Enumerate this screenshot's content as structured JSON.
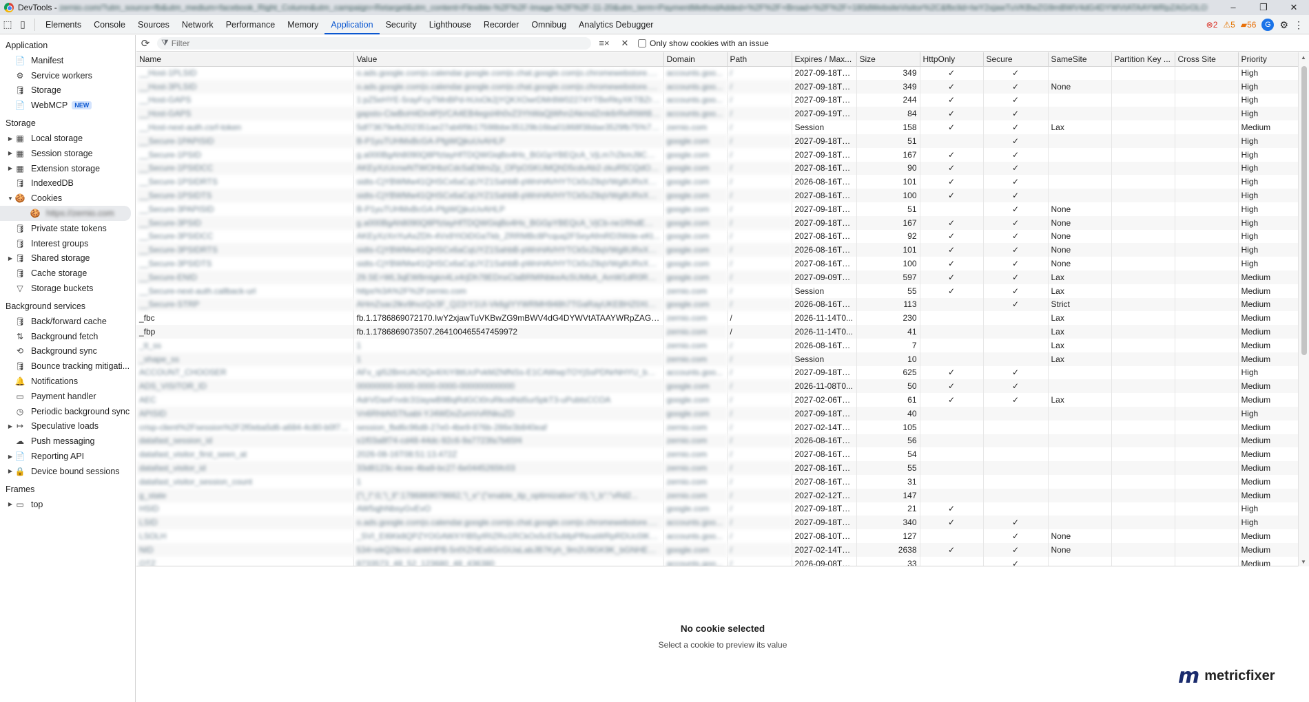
{
  "titlebar": {
    "app": "DevTools",
    "url": "zernio.com/?utm_source=fb&utm_medium=facebook_Right_Column&utm_campaign=Retarget&utm_content=Flexible-%2F%2F-Image-%2F%2F-11-20&utm_term=PaymentMethodAdded+%2F%2F+Broad+%2F%2F+180dWebsiteVisitor%2C&fbclid=IwY2xjawTuVKBwZG9mBWV4dG4DYWVtATAAYWRpZAGrOLO",
    "min": "–",
    "max": "❐",
    "close": "✕"
  },
  "tabs": [
    "Elements",
    "Console",
    "Sources",
    "Network",
    "Performance",
    "Memory",
    "Application",
    "Security",
    "Lighthouse",
    "Recorder",
    "Omnibug",
    "Analytics Debugger"
  ],
  "active_tab": "Application",
  "status": {
    "errors": "2",
    "warnings": "5",
    "issues": "56"
  },
  "sidebar": {
    "application_header": "Application",
    "application_items": [
      {
        "label": "Manifest",
        "icon": "📄"
      },
      {
        "label": "Service workers",
        "icon": "⚙"
      },
      {
        "label": "Storage",
        "icon": "🛢"
      },
      {
        "label": "WebMCP",
        "icon": "📄",
        "badge": "NEW"
      }
    ],
    "storage_header": "Storage",
    "storage_items": [
      {
        "label": "Local storage",
        "icon": "▦",
        "arrow": "▶"
      },
      {
        "label": "Session storage",
        "icon": "▦",
        "arrow": "▶"
      },
      {
        "label": "Extension storage",
        "icon": "▦",
        "arrow": "▶"
      },
      {
        "label": "IndexedDB",
        "icon": "🛢",
        "arrow": ""
      },
      {
        "label": "Cookies",
        "icon": "🍪",
        "arrow": "▼"
      },
      {
        "label": "https://zernio.com",
        "icon": "🍪",
        "arrow": "",
        "child": true
      },
      {
        "label": "Private state tokens",
        "icon": "🛢",
        "arrow": ""
      },
      {
        "label": "Interest groups",
        "icon": "🛢",
        "arrow": ""
      },
      {
        "label": "Shared storage",
        "icon": "🛢",
        "arrow": "▶"
      },
      {
        "label": "Cache storage",
        "icon": "🛢",
        "arrow": ""
      },
      {
        "label": "Storage buckets",
        "icon": "▽",
        "arrow": ""
      }
    ],
    "background_header": "Background services",
    "background_items": [
      {
        "label": "Back/forward cache",
        "icon": "🛢",
        "arrow": ""
      },
      {
        "label": "Background fetch",
        "icon": "⇅",
        "arrow": ""
      },
      {
        "label": "Background sync",
        "icon": "⟲",
        "arrow": ""
      },
      {
        "label": "Bounce tracking mitigati...",
        "icon": "🛢",
        "arrow": ""
      },
      {
        "label": "Notifications",
        "icon": "🔔",
        "arrow": ""
      },
      {
        "label": "Payment handler",
        "icon": "▭",
        "arrow": ""
      },
      {
        "label": "Periodic background sync",
        "icon": "◷",
        "arrow": ""
      },
      {
        "label": "Speculative loads",
        "icon": "↦",
        "arrow": "▶"
      },
      {
        "label": "Push messaging",
        "icon": "☁",
        "arrow": ""
      },
      {
        "label": "Reporting API",
        "icon": "📄",
        "arrow": "▶"
      },
      {
        "label": "Device bound sessions",
        "icon": "🔒",
        "arrow": "▶"
      }
    ],
    "frames_header": "Frames",
    "frames_items": [
      {
        "label": "top",
        "icon": "▭",
        "arrow": "▶"
      }
    ]
  },
  "toolbar": {
    "refresh_icon": "⟳",
    "filter_placeholder": "Filter",
    "clear_filtered_icon": "≡×",
    "clear_icon": "✕",
    "only_issue_label": "Only show cookies with an issue"
  },
  "table": {
    "columns": [
      "Name",
      "Value",
      "Domain",
      "Path",
      "Expires / Max...",
      "Size",
      "HttpOnly",
      "Secure",
      "SameSite",
      "Partition Key ...",
      "Cross Site",
      "Priority"
    ],
    "rows": [
      [
        "__Host-1PLSID",
        "o.ads.google.com|o.calendar.google.com|o.chat.google.com|o.chromewebstore.go...",
        "accounts.goo...",
        "/",
        "2027-09-18T1...",
        "349",
        "✓",
        "✓",
        "",
        "",
        "",
        "High"
      ],
      [
        "__Host-3PLSID",
        "o.ads.google.com|o.calendar.google.com|o.chat.google.com|o.chromewebstore.go...",
        "accounts.goo...",
        "/",
        "2027-09-18T1...",
        "349",
        "✓",
        "✓",
        "None",
        "",
        "",
        "High"
      ],
      [
        "__Host-GAPS",
        "1:pZ5eHYE-5rayFcyTMnBPd-hUoOk2jYQKXOwrDMr8W02274YTBeRkyXKTBZrHT...",
        "accounts.goo...",
        "/",
        "2027-09-18T1...",
        "244",
        "✓",
        "✓",
        "",
        "",
        "",
        "High"
      ],
      [
        "__Host-GAPS",
        "gapsto-CiwBoH4Dn4PjVCA4EB4egsI4h0vZ3YhWaQjWhn2AkmdZmk6rReRtWt8B...",
        "accounts.goo...",
        "/",
        "2027-09-19T2...",
        "84",
        "✓",
        "✓",
        "",
        "",
        "",
        "High"
      ],
      [
        "__Host-next-auth.csrf-token",
        "5df73679efb202351ae27ab6f9b17598bbe35129b16ba01868f38dae3529fb75%7C...",
        "zernio.com",
        "/",
        "Session",
        "158",
        "✓",
        "✓",
        "Lax",
        "",
        "",
        "Medium"
      ],
      [
        "__Secure-1PAPISID",
        "B-P1yuTUHMxBcGA-PfgWQjkuUvAHLP",
        "google.com",
        "/",
        "2027-09-18T1...",
        "51",
        "",
        "✓",
        "",
        "",
        "",
        "High"
      ],
      [
        "__Secure-1PSID",
        "g.a000BgAh8090Q8PfzlayHfTDQWGiqBo4Hs_BGGpYBEQcA_VjLm7rZkmJ9CXFB...",
        "google.com",
        "/",
        "2027-09-18T1...",
        "167",
        "✓",
        "✓",
        "",
        "",
        "",
        "High"
      ],
      [
        "__Secure-1PSIDCC",
        "AKEyXzUcnwNTWOHbzCdc5aEMmZp_OPpOSKUMQhD5cdvAb2-zkuR5CQdOkxyQ...",
        "google.com",
        "/",
        "2027-08-16T0...",
        "90",
        "✓",
        "✓",
        "",
        "",
        "",
        "High"
      ],
      [
        "__Secure-1PSIDRTS",
        "sidts-CjYBWMw41QHSCx6aCqUYZ1SahbB-pWnHAVHYTCk5cZ8qVWg8URxXxBsfb...",
        "google.com",
        "/",
        "2026-08-16T0...",
        "101",
        "✓",
        "✓",
        "",
        "",
        "",
        "High"
      ],
      [
        "__Secure-1PSIDTS",
        "sidts-CjYBWMw41QHSCx6aCqUYZ1SahbB-pWnHAVHYTCk5cZ8qVWg8URxXxBsfb...",
        "google.com",
        "/",
        "2027-08-16T0...",
        "100",
        "✓",
        "✓",
        "",
        "",
        "",
        "High"
      ],
      [
        "__Secure-3PAPISID",
        "B-P1yuTUHMxBcGA-PfgWQjkuUvAHLP",
        "google.com",
        "/",
        "2027-09-18T1...",
        "51",
        "",
        "✓",
        "None",
        "",
        "",
        "High"
      ],
      [
        "__Secure-3PSID",
        "g.a000BgAh8090Q8PfzlayHfTDQWGiqBo4Hs_BGGpYBEQcA_VjCb-ne1RhdEWgJ...",
        "google.com",
        "/",
        "2027-09-18T1...",
        "167",
        "✓",
        "✓",
        "None",
        "",
        "",
        "High"
      ],
      [
        "__Secure-3PSIDCC",
        "AKEyXzXnYuAxZDh-4Vx9YiOiDGaTkb_ZRRMBc8Pcquq2FSeyAfmRD3Wde-eKt...",
        "google.com",
        "/",
        "2027-08-16T0...",
        "92",
        "✓",
        "✓",
        "None",
        "",
        "",
        "High"
      ],
      [
        "__Secure-3PSIDRTS",
        "sidts-CjYBWMw41QHSCx6aCqUYZ1SahbB-pWnHAVHYTCk5cZ8qVWg8URxXxBsfb...",
        "google.com",
        "/",
        "2026-08-16T0...",
        "101",
        "✓",
        "✓",
        "None",
        "",
        "",
        "High"
      ],
      [
        "__Secure-3PSIDTS",
        "sidts-CjYBWMw41QHSCx6aCqUYZ1SahbB-pWnHAVHYTCk5cZ8qVWg8URxXxBsfb...",
        "google.com",
        "/",
        "2027-08-16T0...",
        "100",
        "✓",
        "✓",
        "None",
        "",
        "",
        "High"
      ],
      [
        "__Secure-ENID",
        "29.SE=WL3qEW8mlgkn4Lx4rjDh78EDnxClaBRMINbkeAc5UMbA_AmW1dR0RUm...",
        "google.com",
        "/",
        "2027-09-09T1...",
        "597",
        "✓",
        "✓",
        "Lax",
        "",
        "",
        "Medium"
      ],
      [
        "__Secure-next-auth.callback-url",
        "https%3A%2F%2Fzernio.com",
        "zernio.com",
        "/",
        "Session",
        "55",
        "✓",
        "✓",
        "Lax",
        "",
        "",
        "Medium"
      ],
      [
        "__Secure-STRP",
        "AHmZsac2lkv9hvzQv3F_Q22rY1UI-Vk6gIYYWRMH948h7TGaRayUKEBHZ0Xt63k...",
        "google.com",
        "/",
        "2026-08-16T0...",
        "113",
        "",
        "✓",
        "Strict",
        "",
        "",
        "Medium"
      ],
      [
        "_fbc",
        "fb.1.1786869072170.IwY2xjawTuVKBwZG9mBWV4dG4DYWVtATAAYWRpZAGrOLO...",
        "zernio.com",
        "/",
        "2026-11-14T0...",
        "230",
        "",
        "",
        "Lax",
        "",
        "",
        "Medium"
      ],
      [
        "_fbp",
        "fb.1.1786869073507.264100465547459972",
        "zernio.com",
        "/",
        "2026-11-14T0...",
        "41",
        "",
        "",
        "Lax",
        "",
        "",
        "Medium"
      ],
      [
        "_tt_ss",
        "1",
        "zernio.com",
        "/",
        "2026-08-16T0...",
        "7",
        "",
        "",
        "Lax",
        "",
        "",
        "Medium"
      ],
      [
        "_shape_ss",
        "1",
        "zernio.com",
        "/",
        "Session",
        "10",
        "",
        "",
        "Lax",
        "",
        "",
        "Medium"
      ],
      [
        "ACCOUNT_CHOOSER",
        "AFx_qI52BmUAOIQx4IXiY8ttUcPvkMZNfNSs-E1CAWwpTOYjSsPDNrNHYU_bACRb...",
        "accounts.goo...",
        "/",
        "2027-09-18T1...",
        "625",
        "✓",
        "✓",
        "",
        "",
        "",
        "High"
      ],
      [
        "ADS_VISITOR_ID",
        "00000000-0000-0000-0000-000000000000",
        "google.com",
        "/",
        "2026-11-08T0...",
        "50",
        "✓",
        "✓",
        "",
        "",
        "",
        "Medium"
      ],
      [
        "AEC",
        "AdrVDaxFrvdc31laywB9BqRdGCt0ruRkodNd5ur5pkT3-uPubtsCCOA",
        "google.com",
        "/",
        "2027-02-06T0...",
        "61",
        "✓",
        "✓",
        "Lax",
        "",
        "",
        "Medium"
      ],
      [
        "APISID",
        "Vn6RhbNSTfuabl-YJ4WDoZumVvRNkuZD",
        "google.com",
        "/",
        "2027-09-18T1...",
        "40",
        "",
        "",
        "",
        "",
        "",
        "High"
      ],
      [
        "crisp-client%2Fsession%2F2f0eba5d6-a684-4c80-b0f7-2...",
        "session_fbd6c96d8-27e0-4be9-876b-286e3b840eaf",
        "zernio.com",
        "/",
        "2027-02-14T2...",
        "105",
        "",
        "",
        "",
        "",
        "",
        "Medium"
      ],
      [
        "datafast_session_id",
        "s1f03a8f74-cd48-44dc-92c6-9a7723fa7b65f4",
        "zernio.com",
        "/",
        "2026-08-16T0...",
        "56",
        "",
        "",
        "",
        "",
        "",
        "Medium"
      ],
      [
        "datafast_visitor_first_seen_at",
        "2026-08-16T08:51:13.472Z",
        "zernio.com",
        "/",
        "2027-08-16T0...",
        "54",
        "",
        "",
        "",
        "",
        "",
        "Medium"
      ],
      [
        "datafast_visitor_id",
        "33d8123c-4cee-4ba9-bc27-6e0445265fc03",
        "zernio.com",
        "/",
        "2027-08-16T0...",
        "55",
        "",
        "",
        "",
        "",
        "",
        "Medium"
      ],
      [
        "datafast_visitor_session_count",
        "1",
        "zernio.com",
        "/",
        "2027-08-16T0...",
        "31",
        "",
        "",
        "",
        "",
        "",
        "Medium"
      ],
      [
        "g_state",
        "{\"i_l\":0,\"i_ll\":1786869078662,\"i_e\":{\"enable_itp_optimization\":0},\"i_b\":\"vRd2...",
        "zernio.com",
        "/",
        "2027-02-12T0...",
        "147",
        "",
        "",
        "",
        "",
        "",
        "Medium"
      ],
      [
        "HSID",
        "AW5qjhNbsyGvEvO",
        "google.com",
        "/",
        "2027-09-18T1...",
        "21",
        "✓",
        "",
        "",
        "",
        "",
        "High"
      ],
      [
        "LSID",
        "o.ads.google.com|o.calendar.google.com|o.chat.google.com|o.chromewebstore.go...",
        "accounts.goo...",
        "/",
        "2027-09-18T1...",
        "340",
        "✓",
        "✓",
        "",
        "",
        "",
        "High"
      ],
      [
        "LSOLH",
        "_SVI_EI6Kk8QPZYOGAWXYIB5yIRIZRo1RCkOs5cE5uMpPfNoaWRpRDUc0IKhcpM...",
        "accounts.goo...",
        "/",
        "2027-08-10T0...",
        "127",
        "",
        "✓",
        "None",
        "",
        "",
        "Medium"
      ],
      [
        "NID",
        "534=ekQ2tkrcl-abWHPB-5nfXZHEs6GcGUaLabJB7Kyh_9m2U9GK9K_bGNHEQbn...",
        "google.com",
        "/",
        "2027-02-14T1...",
        "2638",
        "✓",
        "✓",
        "None",
        "",
        "",
        "Medium"
      ],
      [
        "OTZ",
        "8733573_48_52_123680_48_436380",
        "accounts.goo...",
        "/",
        "2026-09-08T2...",
        "33",
        "",
        "✓",
        "",
        "",
        "",
        "Medium"
      ]
    ]
  },
  "preview": {
    "heading": "No cookie selected",
    "subtext": "Select a cookie to preview its value"
  },
  "brand": {
    "mark": "m",
    "name": "metricfixer"
  }
}
